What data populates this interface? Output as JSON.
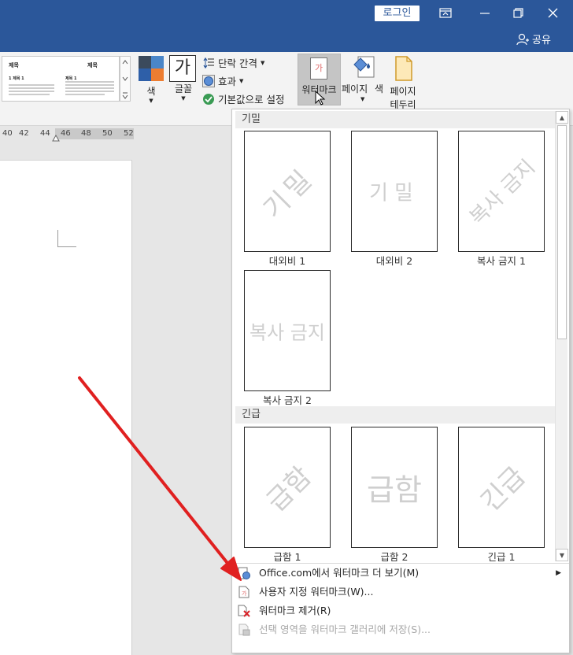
{
  "titlebar": {
    "login_label": "로그인",
    "share_label": "공유",
    "colors": {
      "bg": "#2b579a"
    }
  },
  "ribbon": {
    "preview": {
      "title_left": "제목",
      "title_right": "제목",
      "heading_left": "1 제목 1",
      "heading_right": "제목 1"
    },
    "colors_label": "색",
    "fonts_icon_char": "가",
    "fonts_label": "글꼴",
    "paragraph_spacing_label": "단락 간격",
    "effects_label": "효과",
    "set_default_label": "기본값으로 설정",
    "watermark_label": "워터마크",
    "page_color_label_1": "페이지",
    "page_color_label_2": "색",
    "page_borders_label_1": "페이지",
    "page_borders_label_2": "테두리",
    "watermark_icon_char": "가"
  },
  "ruler": {
    "ticks": [
      "40",
      "42",
      "44",
      "46",
      "48",
      "50",
      "52"
    ]
  },
  "panel": {
    "sections": [
      {
        "header": "기밀",
        "items": [
          {
            "watermark": "기밀",
            "label": "대외비 1",
            "style": "diagonal"
          },
          {
            "watermark": "기밀",
            "label": "대외비 2",
            "style": "horizontal"
          },
          {
            "watermark": "복사 금지",
            "label": "복사 금지 1",
            "style": "diagonal"
          },
          {
            "watermark": "복사 금지",
            "label": "복사 금지 2",
            "style": "horizontal"
          }
        ]
      },
      {
        "header": "긴급",
        "items": [
          {
            "watermark": "급함",
            "label": "급함 1",
            "style": "diagonal"
          },
          {
            "watermark": "급함",
            "label": "급함 2",
            "style": "horizontal"
          },
          {
            "watermark": "긴급",
            "label": "긴급 1",
            "style": "diagonal"
          }
        ]
      }
    ],
    "menu": [
      {
        "label": "Office.com에서 워터마크 더 보기(M)",
        "icon": "globe-icon",
        "disabled": false,
        "submenu": true
      },
      {
        "label": "사용자 지정 워터마크(W)...",
        "icon": "custom-watermark-icon",
        "disabled": false,
        "submenu": false
      },
      {
        "label": "워터마크 제거(R)",
        "icon": "remove-watermark-icon",
        "disabled": false,
        "submenu": false
      },
      {
        "label": "선택 영역을 워터마크 갤러리에 저장(S)...",
        "icon": "save-to-gallery-icon",
        "disabled": true,
        "submenu": false
      }
    ]
  },
  "colors": {
    "annotation_arrow": "#e02020",
    "theme_swatches": [
      "#3b4a5c",
      "#4a86c8",
      "#2e5fa8",
      "#ed7d31"
    ]
  }
}
